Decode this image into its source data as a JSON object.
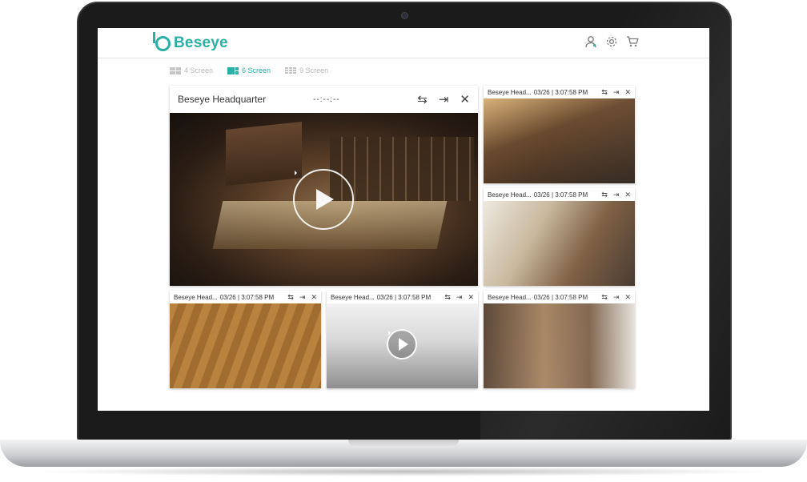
{
  "app": {
    "brand": "Beseye",
    "brand_color": "#2bb0a7",
    "header_icons": [
      "user-icon",
      "gear-icon",
      "cart-icon"
    ]
  },
  "modes": [
    {
      "label": "4 Screen",
      "active": false
    },
    {
      "label": "6 Screen",
      "active": true
    },
    {
      "label": "9 Screen",
      "active": false
    }
  ],
  "main_camera": {
    "title": "Beseye Headquarter",
    "time": "--:--:--",
    "controls": [
      "swap-icon",
      "exit-fullscreen-icon",
      "close-icon"
    ]
  },
  "cameras": [
    {
      "title": "Beseye Head...",
      "timestamp": "03/26 | 3:07:58 PM"
    },
    {
      "title": "Beseye Head...",
      "timestamp": "03/26 | 3:07:58 PM"
    },
    {
      "title": "Beseye Head...",
      "timestamp": "03/26 | 3:07:58 PM"
    },
    {
      "title": "Beseye Head...",
      "timestamp": "03/26 | 3:07:58 PM"
    },
    {
      "title": "Beseye Head...",
      "timestamp": "03/26 | 3:07:58 PM"
    }
  ]
}
